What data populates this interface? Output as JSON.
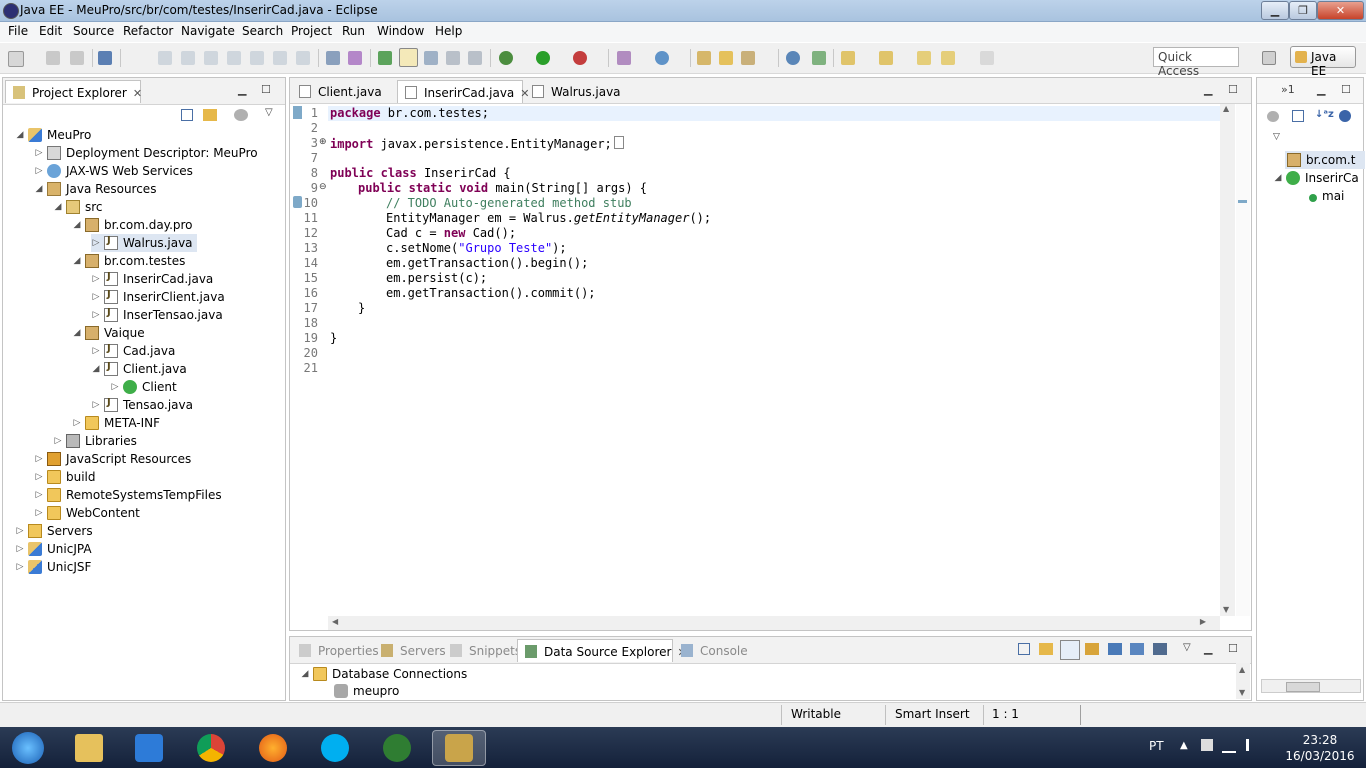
{
  "window": {
    "title": "Java EE - MeuPro/src/br/com/testes/InserirCad.java - Eclipse",
    "minimize": "▁",
    "maximize": "❐",
    "close": "✕"
  },
  "menu": [
    "File",
    "Edit",
    "Source",
    "Refactor",
    "Navigate",
    "Search",
    "Project",
    "Run",
    "Window",
    "Help"
  ],
  "toolbar": {
    "quick_access": "Quick Access",
    "perspective": "Java EE"
  },
  "project_explorer": {
    "title": "Project Explorer",
    "tree": [
      {
        "label": "MeuPro",
        "icon": "project-icon",
        "depth": 0,
        "arrow": "◢"
      },
      {
        "label": "Deployment Descriptor: MeuPro",
        "icon": "descriptor-icon",
        "depth": 1,
        "arrow": "▷"
      },
      {
        "label": "JAX-WS Web Services",
        "icon": "web-services-icon",
        "depth": 1,
        "arrow": "▷"
      },
      {
        "label": "Java Resources",
        "icon": "java-resources-icon",
        "depth": 1,
        "arrow": "◢"
      },
      {
        "label": "src",
        "icon": "source-folder-icon",
        "depth": 2,
        "arrow": "◢"
      },
      {
        "label": "br.com.day.pro",
        "icon": "package-icon",
        "depth": 3,
        "arrow": "◢"
      },
      {
        "label": "Walrus.java",
        "icon": "java-file-icon",
        "depth": 4,
        "arrow": "▷",
        "selected": true
      },
      {
        "label": "br.com.testes",
        "icon": "package-icon",
        "depth": 3,
        "arrow": "◢"
      },
      {
        "label": "InserirCad.java",
        "icon": "java-file-icon",
        "depth": 4,
        "arrow": "▷"
      },
      {
        "label": "InserirClient.java",
        "icon": "java-file-icon",
        "depth": 4,
        "arrow": "▷"
      },
      {
        "label": "InserTensao.java",
        "icon": "java-file-icon",
        "depth": 4,
        "arrow": "▷"
      },
      {
        "label": "Vaique",
        "icon": "package-icon",
        "depth": 3,
        "arrow": "◢"
      },
      {
        "label": "Cad.java",
        "icon": "java-file-icon",
        "depth": 4,
        "arrow": "▷"
      },
      {
        "label": "Client.java",
        "icon": "java-file-icon",
        "depth": 4,
        "arrow": "◢"
      },
      {
        "label": "Client",
        "icon": "class-icon",
        "depth": 5,
        "arrow": "▷"
      },
      {
        "label": "Tensao.java",
        "icon": "java-file-icon",
        "depth": 4,
        "arrow": "▷"
      },
      {
        "label": "META-INF",
        "icon": "folder-icon",
        "depth": 3,
        "arrow": "▷"
      },
      {
        "label": "Libraries",
        "icon": "libraries-icon",
        "depth": 2,
        "arrow": "▷"
      },
      {
        "label": "JavaScript Resources",
        "icon": "javascript-resources-icon",
        "depth": 1,
        "arrow": "▷"
      },
      {
        "label": "build",
        "icon": "folder-icon",
        "depth": 1,
        "arrow": "▷"
      },
      {
        "label": "RemoteSystemsTempFiles",
        "icon": "folder-icon",
        "depth": 1,
        "arrow": "▷"
      },
      {
        "label": "WebContent",
        "icon": "folder-icon",
        "depth": 1,
        "arrow": "▷"
      },
      {
        "label": "Servers",
        "icon": "servers-icon",
        "depth": 0,
        "arrow": "▷"
      },
      {
        "label": "UnicJPA",
        "icon": "project-icon",
        "depth": 0,
        "arrow": "▷"
      },
      {
        "label": "UnicJSF",
        "icon": "project-icon",
        "depth": 0,
        "arrow": "▷"
      }
    ]
  },
  "editor": {
    "tabs": [
      {
        "label": "Client.java",
        "active": false
      },
      {
        "label": "InserirCad.java",
        "active": true
      },
      {
        "label": "Walrus.java",
        "active": false
      }
    ],
    "line_numbers": [
      "1",
      "2",
      "3",
      "7",
      "8",
      "9",
      "10",
      "11",
      "12",
      "13",
      "14",
      "15",
      "16",
      "17",
      "18",
      "19",
      "20",
      "21"
    ],
    "code": {
      "l1_kw": "package",
      "l1_rest": " br.com.testes;",
      "l3_kw": "import",
      "l3_rest": " javax.persistence.EntityManager;",
      "l8_kw1": "public",
      "l8_kw2": "class",
      "l8_rest": " InserirCad {",
      "l9_kw1": "public",
      "l9_kw2": "static",
      "l9_kw3": "void",
      "l9_rest": " main(String[] args) {",
      "l10_comment": "// TODO Auto-generated method stub",
      "l11_a": "EntityManager em = Walrus.",
      "l11_b": "getEntityManager",
      "l11_c": "();",
      "l12_a": "Cad c = ",
      "l12_kw": "new",
      "l12_b": " Cad();",
      "l13_a": "c.setNome(",
      "l13_str": "\"Grupo Teste\"",
      "l13_b": ");",
      "l14": "em.getTransaction().begin();",
      "l15": "em.persist(c);",
      "l16": "em.getTransaction().commit();",
      "l17": "}",
      "l19": "}"
    }
  },
  "outline": {
    "items": [
      "br.com.t",
      "InserirCa",
      "mai"
    ],
    "ctrl_label": "»1"
  },
  "bottom_panel": {
    "tabs": [
      "Properties",
      "Servers",
      "Snippets",
      "Data Source Explorer",
      "Console"
    ],
    "active_tab": "Data Source Explorer",
    "tree": [
      "Database Connections",
      "meupro"
    ]
  },
  "status_bar": {
    "writable": "Writable",
    "insert_mode": "Smart Insert",
    "position": "1 : 1"
  },
  "taskbar": {
    "language": "PT",
    "time": "23:28",
    "date": "16/03/2016",
    "apps": [
      "windows-start",
      "file-explorer",
      "media-player",
      "chrome",
      "firefox",
      "skype",
      "hs-app",
      "eclipse-javaee"
    ]
  },
  "colors": {
    "keyword": "#7f0055",
    "comment": "#3f7f5f",
    "string": "#2a00ff"
  }
}
